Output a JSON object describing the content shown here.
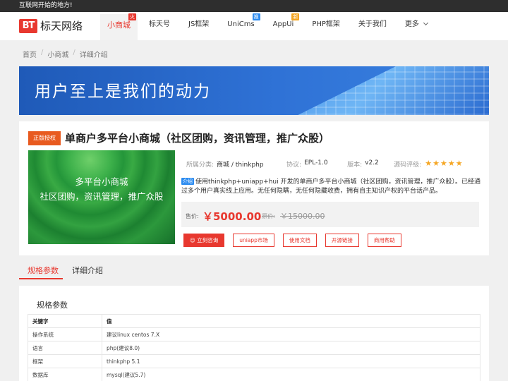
{
  "topbar": {
    "text": "互联网开始的地方!"
  },
  "brand": {
    "mark": "BT",
    "name": "标天网络",
    "color": "#e8382f"
  },
  "nav": {
    "items": [
      {
        "label": "小商城",
        "active": true,
        "badge": "火",
        "badge_color": "#e8382f"
      },
      {
        "label": "标天号",
        "active": false
      },
      {
        "label": "JS框架",
        "active": false
      },
      {
        "label": "UniCms",
        "active": false,
        "badge": "推",
        "badge_color": "#2d8cf0"
      },
      {
        "label": "AppUi",
        "active": false,
        "badge": "新",
        "badge_color": "#f5a623"
      },
      {
        "label": "PHP框架",
        "active": false
      },
      {
        "label": "关于我们",
        "active": false
      },
      {
        "label": "更多",
        "active": false,
        "dropdown": true
      }
    ]
  },
  "breadcrumb": {
    "items": [
      "首页",
      "小商城",
      "详细介绍"
    ],
    "separator": "/"
  },
  "banner": {
    "text": "用户至上是我们的动力"
  },
  "product": {
    "official_label": "正版授权",
    "title": "单商户多平台小商城（社区团购，资讯管理，推广众股）",
    "image_lines": [
      "多平台小商城",
      "社区团购，资讯管理，推广众股"
    ],
    "category_label": "所属分类:",
    "category_value": "商城 / thinkphp",
    "license_label": "协议:",
    "license_value": "EPL-1.0",
    "version_label": "版本:",
    "version_value": "v2.2",
    "rating_label": "源码评级:",
    "rating": 5,
    "rating_max": 5,
    "intro_tag": "介绍",
    "description": "使用thinkphp+uniapp+hui 开发的单商户多平台小商城（社区团购，资讯管理，推广众股）。已经通过多个用户真实线上应用。无任何隐瞒，无任何隐藏收费，拥有自主知识产权的平台话产品。",
    "price_label": "售价:",
    "price": "￥5000.00",
    "old_price_label": "原价:",
    "old_price": "￥15000.00",
    "buttons": [
      {
        "label": "☺ 立刻咨询",
        "primary": true
      },
      {
        "label": "uniapp市场",
        "primary": false
      },
      {
        "label": "使用文档",
        "primary": false
      },
      {
        "label": "开源链接",
        "primary": false
      },
      {
        "label": "商用帮助",
        "primary": false
      }
    ]
  },
  "tabs": {
    "items": [
      "规格参数",
      "详细介绍"
    ],
    "active": 0
  },
  "specs": {
    "title": "规格参数",
    "columns": [
      "关键字",
      "值"
    ],
    "rows": [
      [
        "操作系统",
        "建议linux centos 7.X"
      ],
      [
        "语言",
        "php(建议8.0)"
      ],
      [
        "框架",
        "thinkphp 5.1"
      ],
      [
        "数据库",
        "mysql(建议5.7)"
      ]
    ]
  }
}
